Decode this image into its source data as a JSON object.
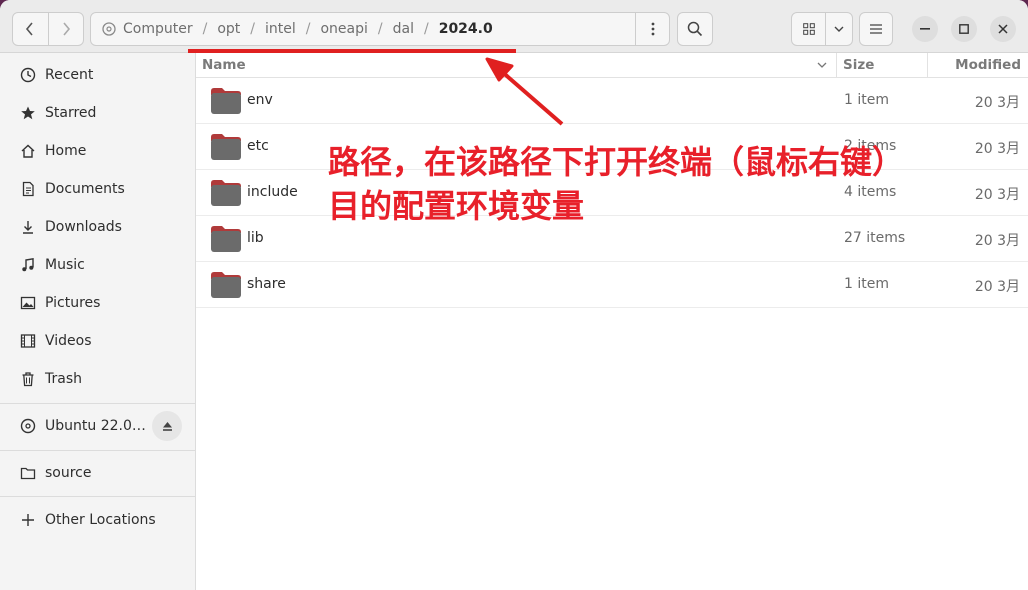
{
  "header": {
    "path": [
      "Computer",
      "opt",
      "intel",
      "oneapi",
      "dal"
    ],
    "current": "2024.0",
    "separator": "/"
  },
  "sidebar": {
    "items": [
      {
        "label": "Recent",
        "icon": "clock-icon"
      },
      {
        "label": "Starred",
        "icon": "star-icon"
      },
      {
        "label": "Home",
        "icon": "home-icon"
      },
      {
        "label": "Documents",
        "icon": "document-icon"
      },
      {
        "label": "Downloads",
        "icon": "download-icon"
      },
      {
        "label": "Music",
        "icon": "music-note-icon"
      },
      {
        "label": "Pictures",
        "icon": "picture-icon"
      },
      {
        "label": "Videos",
        "icon": "film-icon"
      },
      {
        "label": "Trash",
        "icon": "trash-icon"
      }
    ],
    "drive": {
      "label": "Ubuntu 22.0…",
      "icon": "disc-icon"
    },
    "bookmark": {
      "label": "source",
      "icon": "folder-icon"
    },
    "other": {
      "label": "Other Locations",
      "icon": "plus-icon"
    }
  },
  "columns": {
    "name": "Name",
    "size": "Size",
    "modified": "Modified"
  },
  "files": [
    {
      "name": "env",
      "size": "1 item",
      "modified": "20 3月"
    },
    {
      "name": "etc",
      "size": "2 items",
      "modified": "20 3月"
    },
    {
      "name": "include",
      "size": "4 items",
      "modified": "20 3月"
    },
    {
      "name": "lib",
      "size": "27 items",
      "modified": "20 3月"
    },
    {
      "name": "share",
      "size": "1 item",
      "modified": "20 3月"
    }
  ],
  "annotation": {
    "line1": "路径，在该路径下打开终端（鼠标右键）",
    "line2": "目的配置环境变量",
    "color": "#e8202a"
  },
  "colors": {
    "folder_body": "#6b6b6b",
    "folder_tab": "#c0392b",
    "accent_red": "#e02020"
  }
}
